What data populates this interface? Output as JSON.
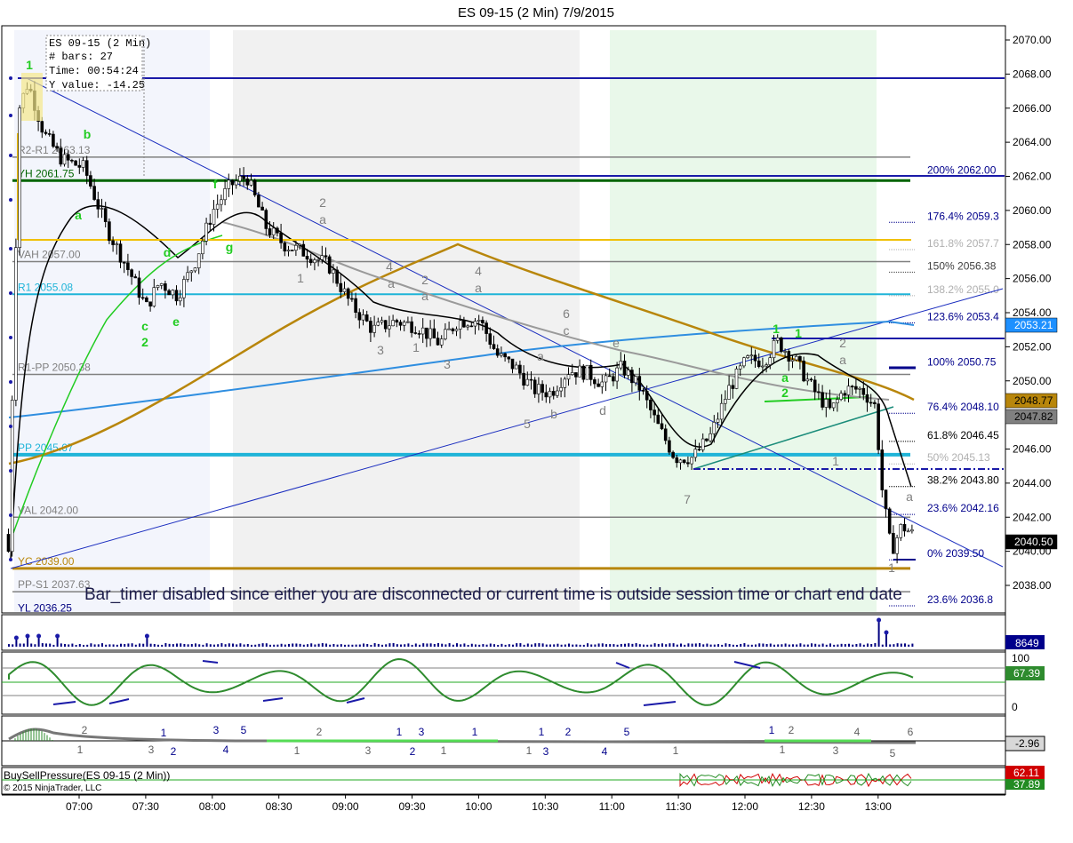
{
  "title": "ES 09-15 (2 Min)  7/9/2015",
  "info_box": {
    "lines": [
      "ES 09-15 (2 Min)",
      "# bars:    27",
      "Time:      00:54:24",
      "Y value:  -14.25"
    ]
  },
  "banner": "Bar_timer disabled since either you are disconnected or current time is outside session time or chart end date",
  "price_axis": {
    "ticks": [
      "2070.00",
      "2068.00",
      "2066.00",
      "2064.00",
      "2062.00",
      "2060.00",
      "2058.00",
      "2056.00",
      "2054.00",
      "2052.00",
      "2050.00",
      "2048.00",
      "2046.00",
      "2044.00",
      "2042.00",
      "2040.00",
      "2038.00"
    ]
  },
  "time_axis": {
    "ticks": [
      "07:00",
      "07:30",
      "08:00",
      "08:30",
      "09:00",
      "09:30",
      "10:00",
      "10:30",
      "11:00",
      "11:30",
      "12:00",
      "12:30",
      "13:00"
    ]
  },
  "price_badges": [
    {
      "text": "2053.21",
      "bg": "#1e90ff",
      "fg": "#ffffff"
    },
    {
      "text": "2048.77",
      "bg": "#b8860b",
      "fg": "#000000"
    },
    {
      "text": "2047.82",
      "bg": "#808080",
      "fg": "#000000"
    },
    {
      "text": "2040.50",
      "bg": "#000000",
      "fg": "#ffffff"
    }
  ],
  "levels": [
    {
      "label": "R2-R1 2063.13",
      "price": 2063.13,
      "color": "#808080"
    },
    {
      "label": "YH 2061.75",
      "price": 2061.75,
      "color": "#006400"
    },
    {
      "label": "VAH 2057.00",
      "price": 2057.0,
      "color": "#808080"
    },
    {
      "label": "R1 2055.08",
      "price": 2055.08,
      "color": "#1fb4d8"
    },
    {
      "label": "R1-PP 2050.38",
      "price": 2050.38,
      "color": "#808080"
    },
    {
      "label": "PP 2045.67",
      "price": 2045.67,
      "color": "#1fb4d8"
    },
    {
      "label": "VAL 2042.00",
      "price": 2042.0,
      "color": "#808080"
    },
    {
      "label": "YC 2039.00",
      "price": 2039.0,
      "color": "#b8860b"
    },
    {
      "label": "PP-S1 2037.63",
      "price": 2037.63,
      "color": "#808080"
    },
    {
      "label": "YL 2036.25",
      "price": 2036.25,
      "color": "#000080"
    }
  ],
  "fib_levels": [
    {
      "label": "200%  2062.00",
      "price": 2062.0,
      "color": "#00008b"
    },
    {
      "label": "176.4%  2059.3",
      "price": 2059.3,
      "color": "#00008b"
    },
    {
      "label": "161.8%  2057.7",
      "price": 2057.7,
      "color": "#b0b0b0"
    },
    {
      "label": "150%  2056.38",
      "price": 2056.38,
      "color": "#404040"
    },
    {
      "label": "138.2%  2055.0",
      "price": 2055.0,
      "color": "#b0b0b0"
    },
    {
      "label": "123.6%  2053.4",
      "price": 2053.4,
      "color": "#00008b"
    },
    {
      "label": "100%  2050.75",
      "price": 2050.75,
      "color": "#00008b"
    },
    {
      "label": "76.4%  2048.10",
      "price": 2048.1,
      "color": "#00008b"
    },
    {
      "label": "61.8%  2046.45",
      "price": 2046.45,
      "color": "#000000"
    },
    {
      "label": "50%  2045.13",
      "price": 2045.13,
      "color": "#b0b0b0"
    },
    {
      "label": "38.2%  2043.80",
      "price": 2043.8,
      "color": "#000000"
    },
    {
      "label": "23.6%  2042.16",
      "price": 2042.16,
      "color": "#00008b"
    },
    {
      "label": "0%  2039.50",
      "price": 2039.5,
      "color": "#00008b"
    },
    {
      "label": "23.6%  2036.8",
      "price": 2036.8,
      "color": "#00008b"
    }
  ],
  "wave_labels": [
    {
      "t": "1",
      "c": "#22cc22"
    },
    {
      "t": "b",
      "c": "#22cc22"
    },
    {
      "t": "a",
      "c": "#22cc22"
    },
    {
      "t": "d",
      "c": "#22cc22"
    },
    {
      "t": "c",
      "c": "#22cc22"
    },
    {
      "t": "2",
      "c": "#22cc22"
    },
    {
      "t": "e",
      "c": "#22cc22"
    },
    {
      "t": "f",
      "c": "#22cc22"
    },
    {
      "t": "g",
      "c": "#22cc22"
    },
    {
      "t": "2",
      "c": "#808080"
    },
    {
      "t": "a",
      "c": "#808080"
    },
    {
      "t": "1",
      "c": "#808080"
    },
    {
      "t": "4",
      "c": "#808080"
    },
    {
      "t": "a",
      "c": "#808080"
    },
    {
      "t": "3",
      "c": "#808080"
    },
    {
      "t": "2",
      "c": "#808080"
    },
    {
      "t": "a",
      "c": "#808080"
    },
    {
      "t": "1",
      "c": "#808080"
    },
    {
      "t": "4",
      "c": "#808080"
    },
    {
      "t": "a",
      "c": "#808080"
    },
    {
      "t": "3",
      "c": "#808080"
    },
    {
      "t": "6",
      "c": "#808080"
    },
    {
      "t": "c",
      "c": "#808080"
    },
    {
      "t": "a",
      "c": "#808080"
    },
    {
      "t": "5",
      "c": "#808080"
    },
    {
      "t": "b",
      "c": "#808080"
    },
    {
      "t": "e",
      "c": "#808080"
    },
    {
      "t": "d",
      "c": "#808080"
    },
    {
      "t": "7",
      "c": "#808080"
    },
    {
      "t": "1",
      "c": "#22cc22"
    },
    {
      "t": "1",
      "c": "#22cc22"
    },
    {
      "t": "a",
      "c": "#22cc22"
    },
    {
      "t": "2",
      "c": "#22cc22"
    },
    {
      "t": "2",
      "c": "#808080"
    },
    {
      "t": "a",
      "c": "#808080"
    },
    {
      "t": "1",
      "c": "#808080"
    },
    {
      "t": "a",
      "c": "#808080"
    },
    {
      "t": "1",
      "c": "#808080"
    }
  ],
  "volume_panel": {
    "badge": "8649"
  },
  "oscillator_panel": {
    "top": "100",
    "bottom": "0",
    "badge": "67.39"
  },
  "wave_panel": {
    "badge": "-2.96",
    "labels": [
      {
        "t": "2",
        "c": "#606060"
      },
      {
        "t": "1",
        "c": "#606060"
      },
      {
        "t": "3",
        "c": "#606060"
      },
      {
        "t": "2",
        "c": "#00008b"
      },
      {
        "t": "1",
        "c": "#00008b"
      },
      {
        "t": "3",
        "c": "#00008b"
      },
      {
        "t": "4",
        "c": "#00008b"
      },
      {
        "t": "5",
        "c": "#00008b"
      },
      {
        "t": "2",
        "c": "#606060"
      },
      {
        "t": "1",
        "c": "#606060"
      },
      {
        "t": "3",
        "c": "#606060"
      },
      {
        "t": "1",
        "c": "#00008b"
      },
      {
        "t": "3",
        "c": "#00008b"
      },
      {
        "t": "2",
        "c": "#00008b"
      },
      {
        "t": "1",
        "c": "#606060"
      },
      {
        "t": "1",
        "c": "#00008b"
      },
      {
        "t": "1",
        "c": "#00008b"
      },
      {
        "t": "3",
        "c": "#00008b"
      },
      {
        "t": "1",
        "c": "#606060"
      },
      {
        "t": "2",
        "c": "#00008b"
      },
      {
        "t": "4",
        "c": "#00008b"
      },
      {
        "t": "5",
        "c": "#00008b"
      },
      {
        "t": "1",
        "c": "#606060"
      },
      {
        "t": "1",
        "c": "#00008b"
      },
      {
        "t": "2",
        "c": "#606060"
      },
      {
        "t": "1",
        "c": "#606060"
      },
      {
        "t": "3",
        "c": "#606060"
      },
      {
        "t": "4",
        "c": "#606060"
      },
      {
        "t": "6",
        "c": "#606060"
      },
      {
        "t": "5",
        "c": "#606060"
      }
    ]
  },
  "pressure_panel": {
    "label": "BuySellPressure(ES 09-15 (2 Min))",
    "copyright": "© 2015 NinjaTrader, LLC",
    "badge_top": "62.11",
    "badge_bottom": "37.89"
  }
}
